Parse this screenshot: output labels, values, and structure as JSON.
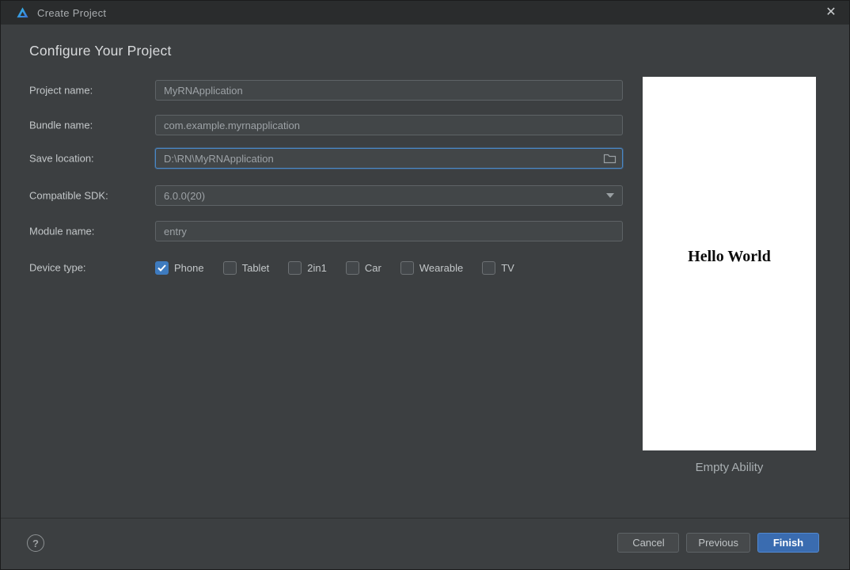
{
  "window": {
    "title": "Create Project",
    "close_glyph": "✕"
  },
  "header": {
    "title": "Configure Your Project"
  },
  "form": {
    "project_name": {
      "label": "Project name:",
      "value": "MyRNApplication"
    },
    "bundle_name": {
      "label": "Bundle name:",
      "value": "com.example.myrnapplication"
    },
    "save_location": {
      "label": "Save location:",
      "value": "D:\\RN\\MyRNApplication",
      "focused": true,
      "browse_icon": "folder-icon"
    },
    "compatible_sdk": {
      "label": "Compatible SDK:",
      "value": "6.0.0(20)"
    },
    "module_name": {
      "label": "Module name:",
      "value": "entry"
    },
    "device_type": {
      "label": "Device type:",
      "options": [
        {
          "label": "Phone",
          "checked": true
        },
        {
          "label": "Tablet",
          "checked": false
        },
        {
          "label": "2in1",
          "checked": false
        },
        {
          "label": "Car",
          "checked": false
        },
        {
          "label": "Wearable",
          "checked": false
        },
        {
          "label": "TV",
          "checked": false
        }
      ]
    }
  },
  "preview": {
    "screen_text": "Hello World",
    "caption": "Empty Ability"
  },
  "footer": {
    "help_glyph": "?",
    "cancel_label": "Cancel",
    "previous_label": "Previous",
    "finish_label": "Finish"
  },
  "colors": {
    "accent_checkbox": "#3e7bbf",
    "focus_border": "#4a88c7",
    "finish_button": "#3a6cb0",
    "window_background": "#3c3f41",
    "titlebar_background": "#2a2c2d",
    "preview_background": "#ffffff"
  }
}
